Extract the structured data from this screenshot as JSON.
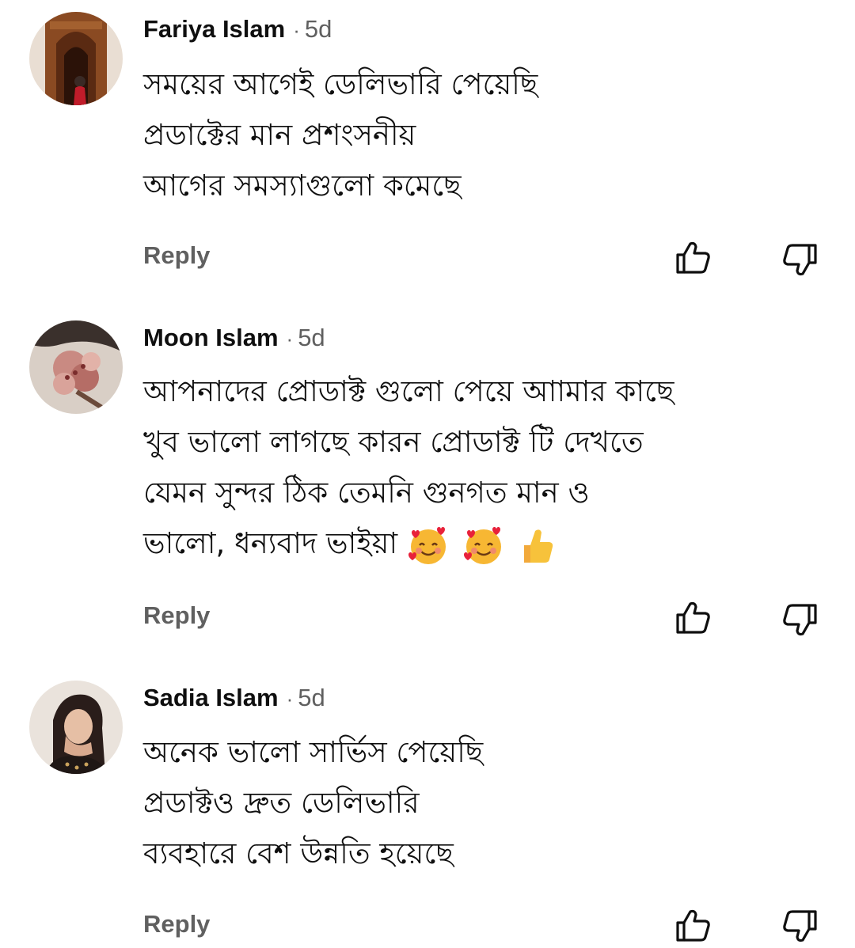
{
  "comments": [
    {
      "author": "Fariya Islam",
      "separator": "·",
      "time": "5d",
      "lines": [
        "সময়ের আগেই ডেলিভারি পেয়েছি",
        "প্রডাক্টের মান প্রশংসনীয়",
        "আগের সমস্যাগুলো কমেছে"
      ],
      "reply_label": "Reply",
      "like_icon": "thumbs-up-outline",
      "dislike_icon": "thumbs-down-outline"
    },
    {
      "author": "Moon Islam",
      "separator": "·",
      "time": "5d",
      "lines": [
        "আপনাদের প্রোডাক্ট গুলো পেয়ে আামার কাছে",
        "খুব ভালো লাগছে কারন প্রোডাক্ট টি দেখতে",
        "যেমন সুন্দর ঠিক তেমনি গুনগত মান ও",
        "ভালো,  ধন্যবাদ ভাইয়া"
      ],
      "emojis": [
        "smiling-face-with-hearts",
        "smiling-face-with-hearts",
        "thumbs-up"
      ],
      "reply_label": "Reply",
      "like_icon": "thumbs-up-outline",
      "dislike_icon": "thumbs-down-outline"
    },
    {
      "author": "Sadia Islam",
      "separator": "·",
      "time": "5d",
      "lines": [
        "অনেক ভালো সার্ভিস পেয়েছি",
        "প্রডাক্টও দ্রুত ডেলিভারি",
        "ব্যবহারে বেশ উন্নতি হয়েছে"
      ],
      "reply_label": "Reply",
      "like_icon": "thumbs-up-outline",
      "dislike_icon": "thumbs-down-outline"
    }
  ],
  "colors": {
    "author": "#0f0f0f",
    "secondary": "#606060",
    "text": "#0f0f0f",
    "background": "#ffffff"
  }
}
